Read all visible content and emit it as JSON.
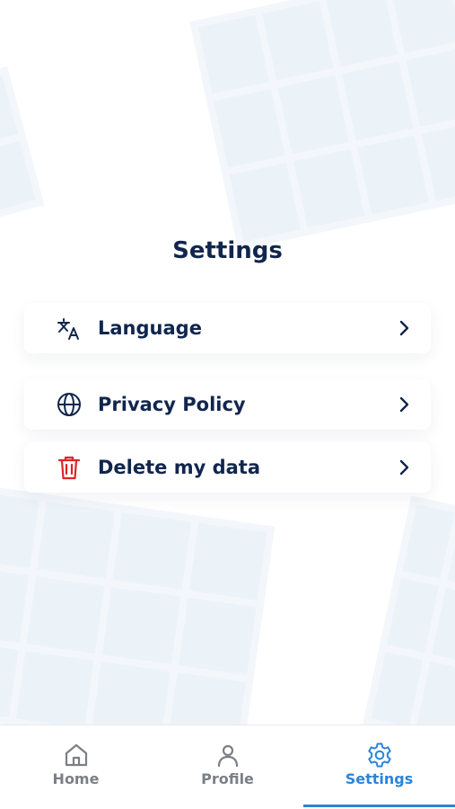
{
  "page": {
    "title": "Settings"
  },
  "menu": {
    "items": [
      {
        "label": "Language",
        "icon": "translate-icon"
      },
      {
        "label": "Privacy Policy",
        "icon": "globe-icon"
      },
      {
        "label": "Delete my data",
        "icon": "trash-icon"
      }
    ]
  },
  "tabs": {
    "items": [
      {
        "label": "Home",
        "icon": "home-icon",
        "active": false
      },
      {
        "label": "Profile",
        "icon": "user-icon",
        "active": false
      },
      {
        "label": "Settings",
        "icon": "gear-icon",
        "active": true
      }
    ]
  },
  "colors": {
    "title": "#11264d",
    "danger": "#e02424",
    "accent": "#2c84d8",
    "inactive_tab": "#7b7f86"
  }
}
